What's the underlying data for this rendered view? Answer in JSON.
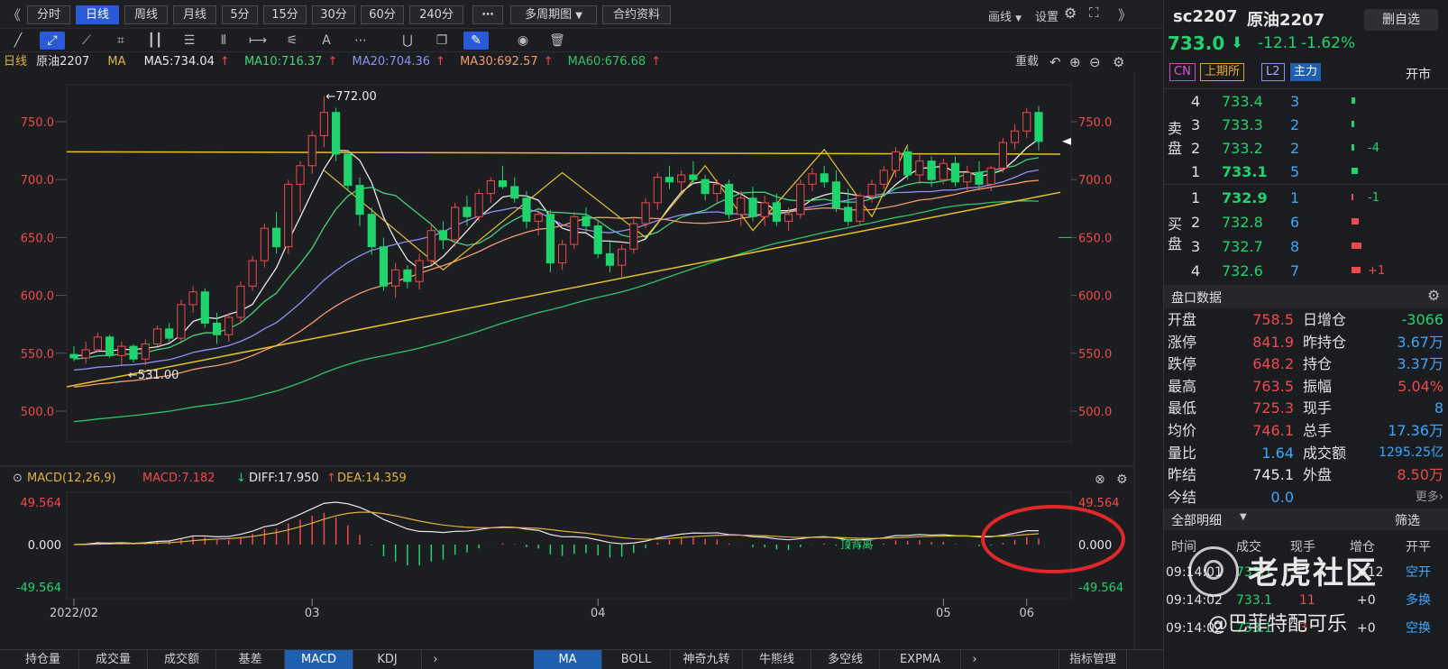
{
  "toolbar": {
    "periods": [
      "分时",
      "日线",
      "周线",
      "月线",
      "5分",
      "15分",
      "30分",
      "60分",
      "240分"
    ],
    "active_period": "日线",
    "more": "⋯",
    "multi_period": "多周期图",
    "contract_info": "合约资料",
    "draw_line": "画线",
    "settings": "设置"
  },
  "ma_bar": {
    "period": "日线",
    "name": "原油2207",
    "ma_label": "MA",
    "ma5": "MA5:734.04",
    "ma10": "MA10:716.37",
    "ma20": "MA20:704.36",
    "ma30": "MA30:692.57",
    "ma60": "MA60:676.68",
    "reload": "重载",
    "colors": {
      "ma5": "#e8e8e8",
      "ma10": "#3fd47a",
      "ma20": "#8f8ff5",
      "ma30": "#f59a6a",
      "ma60": "#2fc36a"
    }
  },
  "macd_bar": {
    "label": "MACD(12,26,9)",
    "macd": "MACD:7.182",
    "diff": "DIFF:17.950",
    "dea": "DEA:14.359"
  },
  "chart_data": [
    {
      "type": "candlestick",
      "title": "原油2207",
      "yticks": [
        500.0,
        550.0,
        600.0,
        650.0,
        700.0,
        750.0
      ],
      "ylim": [
        480,
        785
      ],
      "xticks": [
        "2022/02",
        "03",
        "04",
        "05",
        "06"
      ],
      "annotations": {
        "high": "←772.00",
        "low": "←531.00"
      },
      "last_price_marker": 733.0,
      "ohlc": [
        [
          549,
          556,
          543,
          546
        ],
        [
          546,
          560,
          541,
          553
        ],
        [
          553,
          568,
          551,
          564
        ],
        [
          564,
          566,
          546,
          548
        ],
        [
          548,
          560,
          540,
          556
        ],
        [
          556,
          558,
          542,
          545
        ],
        [
          545,
          562,
          540,
          558
        ],
        [
          558,
          574,
          556,
          571
        ],
        [
          571,
          576,
          560,
          563
        ],
        [
          563,
          596,
          560,
          592
        ],
        [
          592,
          608,
          585,
          603
        ],
        [
          603,
          606,
          572,
          576
        ],
        [
          576,
          585,
          558,
          566
        ],
        [
          566,
          585,
          560,
          581
        ],
        [
          581,
          612,
          576,
          608
        ],
        [
          608,
          634,
          604,
          630
        ],
        [
          630,
          662,
          624,
          658
        ],
        [
          658,
          672,
          636,
          642
        ],
        [
          642,
          700,
          636,
          696
        ],
        [
          696,
          716,
          672,
          712
        ],
        [
          712,
          742,
          705,
          738
        ],
        [
          738,
          772,
          728,
          758
        ],
        [
          758,
          762,
          716,
          722
        ],
        [
          722,
          725,
          690,
          695
        ],
        [
          695,
          702,
          660,
          670
        ],
        [
          670,
          676,
          635,
          642
        ],
        [
          642,
          650,
          604,
          608
        ],
        [
          608,
          628,
          598,
          622
        ],
        [
          622,
          626,
          606,
          612
        ],
        [
          612,
          636,
          605,
          630
        ],
        [
          630,
          662,
          626,
          656
        ],
        [
          656,
          664,
          640,
          648
        ],
        [
          648,
          680,
          642,
          676
        ],
        [
          676,
          686,
          660,
          668
        ],
        [
          668,
          692,
          664,
          688
        ],
        [
          688,
          702,
          680,
          699
        ],
        [
          699,
          712,
          692,
          694
        ],
        [
          694,
          702,
          680,
          684
        ],
        [
          684,
          690,
          658,
          664
        ],
        [
          664,
          676,
          652,
          670
        ],
        [
          670,
          674,
          620,
          628
        ],
        [
          628,
          648,
          622,
          644
        ],
        [
          644,
          672,
          640,
          668
        ],
        [
          668,
          676,
          655,
          660
        ],
        [
          660,
          664,
          632,
          636
        ],
        [
          636,
          648,
          620,
          626
        ],
        [
          626,
          644,
          616,
          640
        ],
        [
          640,
          666,
          636,
          662
        ],
        [
          662,
          684,
          658,
          680
        ],
        [
          680,
          706,
          674,
          702
        ],
        [
          702,
          712,
          692,
          698
        ],
        [
          698,
          708,
          690,
          704
        ],
        [
          704,
          716,
          696,
          700
        ],
        [
          700,
          704,
          682,
          688
        ],
        [
          688,
          700,
          680,
          696
        ],
        [
          696,
          700,
          666,
          670
        ],
        [
          670,
          690,
          660,
          684
        ],
        [
          684,
          694,
          664,
          668
        ],
        [
          668,
          686,
          660,
          680
        ],
        [
          680,
          688,
          660,
          664
        ],
        [
          664,
          676,
          656,
          670
        ],
        [
          670,
          700,
          666,
          696
        ],
        [
          696,
          710,
          690,
          705
        ],
        [
          705,
          712,
          693,
          698
        ],
        [
          698,
          708,
          672,
          676
        ],
        [
          676,
          692,
          660,
          664
        ],
        [
          664,
          688,
          660,
          686
        ],
        [
          686,
          700,
          680,
          696
        ],
        [
          696,
          712,
          692,
          708
        ],
        [
          708,
          728,
          702,
          724
        ],
        [
          724,
          728,
          700,
          704
        ],
        [
          704,
          722,
          696,
          716
        ],
        [
          716,
          720,
          694,
          700
        ],
        [
          700,
          718,
          696,
          714
        ],
        [
          714,
          720,
          694,
          698
        ],
        [
          698,
          712,
          690,
          706
        ],
        [
          706,
          716,
          692,
          696
        ],
        [
          696,
          712,
          690,
          710
        ],
        [
          710,
          736,
          706,
          732
        ],
        [
          732,
          748,
          726,
          742
        ],
        [
          742,
          762,
          736,
          758
        ],
        [
          758,
          763.5,
          725.3,
          733
        ]
      ],
      "ma_series": [
        "MA5",
        "MA10",
        "MA20",
        "MA30",
        "MA60"
      ]
    },
    {
      "type": "bar",
      "title": "MACD(12,26,9)",
      "yticks": [
        49.564,
        0.0,
        -49.564
      ],
      "ylim": [
        -49.564,
        49.564
      ],
      "annotations": {
        "divergence": "顶背离"
      },
      "diff_end": 17.95,
      "dea_end": 14.359,
      "macd_end": 7.182
    }
  ],
  "right": {
    "code": "sc2207",
    "name": "原油2207",
    "remove_btn": "删自选",
    "price": "733.0",
    "arrow": "⬇",
    "change": "-12.1",
    "change_pct": "-1.62%",
    "tags": [
      "CN",
      "上期所",
      "L2",
      "主力"
    ],
    "open_text": "开市",
    "sell_label": "卖盘",
    "buy_label": "买盘",
    "asks": [
      {
        "lvl": "4",
        "px": "733.4",
        "vol": "3",
        "chg": ""
      },
      {
        "lvl": "3",
        "px": "733.3",
        "vol": "2",
        "chg": ""
      },
      {
        "lvl": "2",
        "px": "733.2",
        "vol": "2",
        "chg": "-4"
      },
      {
        "lvl": "1",
        "px": "733.1",
        "vol": "5",
        "chg": ""
      }
    ],
    "bids": [
      {
        "lvl": "1",
        "px": "732.9",
        "vol": "1",
        "chg": "-1"
      },
      {
        "lvl": "2",
        "px": "732.8",
        "vol": "6",
        "chg": ""
      },
      {
        "lvl": "3",
        "px": "732.7",
        "vol": "8",
        "chg": ""
      },
      {
        "lvl": "4",
        "px": "732.6",
        "vol": "7",
        "chg": "+1"
      }
    ],
    "pankou_title": "盘口数据",
    "stats": [
      {
        "k1": "开盘",
        "v1": "758.5",
        "k2": "日增仓",
        "v2": "-3066"
      },
      {
        "k1": "涨停",
        "v1": "841.9",
        "k2": "昨持仓",
        "v2": "3.67万"
      },
      {
        "k1": "跌停",
        "v1": "648.2",
        "k2": "持仓",
        "v2": "3.37万"
      },
      {
        "k1": "最高",
        "v1": "763.5",
        "k2": "振幅",
        "v2": "5.04%"
      },
      {
        "k1": "最低",
        "v1": "725.3",
        "k2": "现手",
        "v2": "8"
      },
      {
        "k1": "均价",
        "v1": "746.1",
        "k2": "总手",
        "v2": "17.36万"
      },
      {
        "k1": "量比",
        "v1": "1.64",
        "k2": "成交额",
        "v2": "1295.25亿"
      },
      {
        "k1": "昨结",
        "v1": "745.1",
        "k2": "外盘",
        "v2": "8.50万"
      },
      {
        "k1": "今结",
        "v1": "0.0",
        "k2": "",
        "v2": "更多›"
      }
    ],
    "detail_title": "全部明细",
    "filter": "筛选",
    "detail_headers": [
      "时间",
      "成交",
      "现手",
      "增仓",
      "开平"
    ],
    "details": [
      {
        "t": "09:14:01",
        "px": "733.1",
        "vol": "",
        "oi": "+12",
        "op": "空开"
      },
      {
        "t": "09:14:02",
        "px": "733.1",
        "vol": "11",
        "oi": "+0",
        "op": "多换"
      },
      {
        "t": "09:14:02",
        "px": "733.1",
        "vol": "3",
        "oi": "+0",
        "op": "空换"
      }
    ]
  },
  "bottom": {
    "left_tabs": [
      "持仓量",
      "成交量",
      "成交额",
      "基差",
      "MACD",
      "KDJ"
    ],
    "left_active": "MACD",
    "right_tabs": [
      "MA",
      "BOLL",
      "神奇九转",
      "牛熊线",
      "多空线",
      "EXPMA"
    ],
    "right_active": "MA",
    "manage": "指标管理"
  },
  "watermark": {
    "brand": "老虎社区",
    "handle": "@巴菲特配可乐"
  }
}
